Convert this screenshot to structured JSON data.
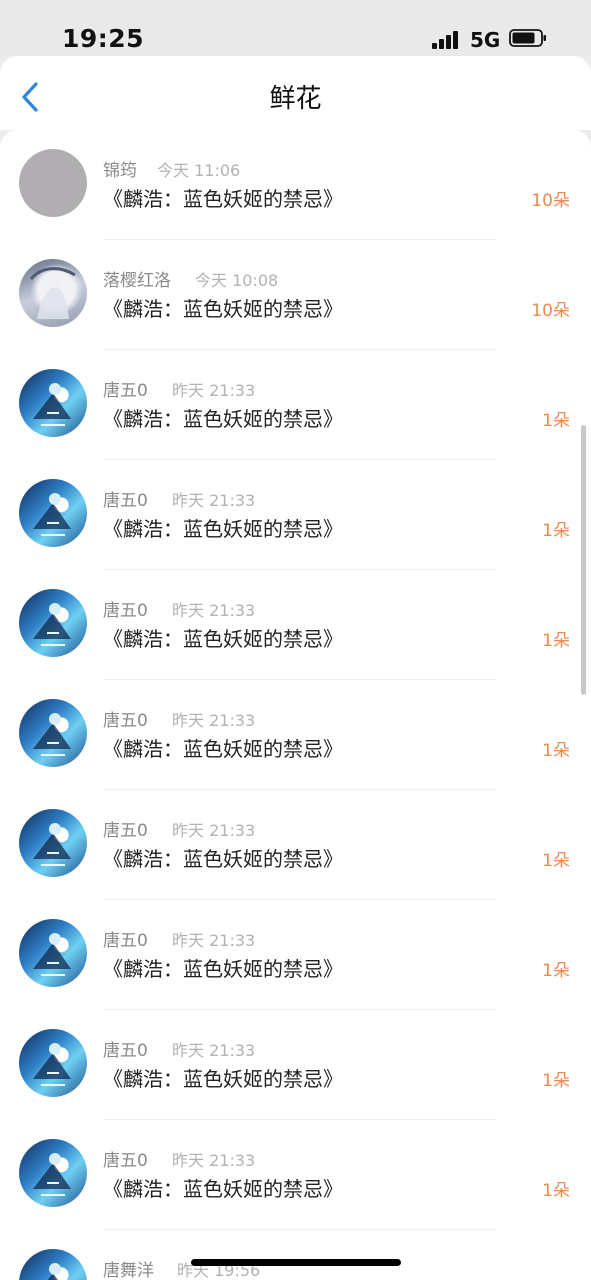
{
  "status_bar": {
    "time": "19:25",
    "network": "5G",
    "icons": [
      "signal-icon",
      "battery-icon"
    ]
  },
  "nav": {
    "title": "鲜花",
    "back_icon": "chevron-left-icon",
    "accent_color": "#2f86d8"
  },
  "colors": {
    "count": "#ee8a4e",
    "meta": "#8a8a8a"
  },
  "entries": [
    {
      "name": "锦筠",
      "time": "今天 11:06",
      "title": "《麟浩：蓝色妖姬的禁忌》",
      "count": "10朵"
    },
    {
      "name": "落樱红洛",
      "time": "今天 10:08",
      "title": "《麟浩：蓝色妖姬的禁忌》",
      "count": "10朵"
    },
    {
      "name": "唐五0",
      "time": "昨天 21:33",
      "title": "《麟浩：蓝色妖姬的禁忌》",
      "count": "1朵"
    },
    {
      "name": "唐五0",
      "time": "昨天 21:33",
      "title": "《麟浩：蓝色妖姬的禁忌》",
      "count": "1朵"
    },
    {
      "name": "唐五0",
      "time": "昨天 21:33",
      "title": "《麟浩：蓝色妖姬的禁忌》",
      "count": "1朵"
    },
    {
      "name": "唐五0",
      "time": "昨天 21:33",
      "title": "《麟浩：蓝色妖姬的禁忌》",
      "count": "1朵"
    },
    {
      "name": "唐五0",
      "time": "昨天 21:33",
      "title": "《麟浩：蓝色妖姬的禁忌》",
      "count": "1朵"
    },
    {
      "name": "唐五0",
      "time": "昨天 21:33",
      "title": "《麟浩：蓝色妖姬的禁忌》",
      "count": "1朵"
    },
    {
      "name": "唐五0",
      "time": "昨天 21:33",
      "title": "《麟浩：蓝色妖姬的禁忌》",
      "count": "1朵"
    },
    {
      "name": "唐五0",
      "time": "昨天 21:33",
      "title": "《麟浩：蓝色妖姬的禁忌》",
      "count": "1朵"
    },
    {
      "name": "唐舞洋",
      "time": "昨天 19:56",
      "title": "",
      "count": ""
    }
  ]
}
